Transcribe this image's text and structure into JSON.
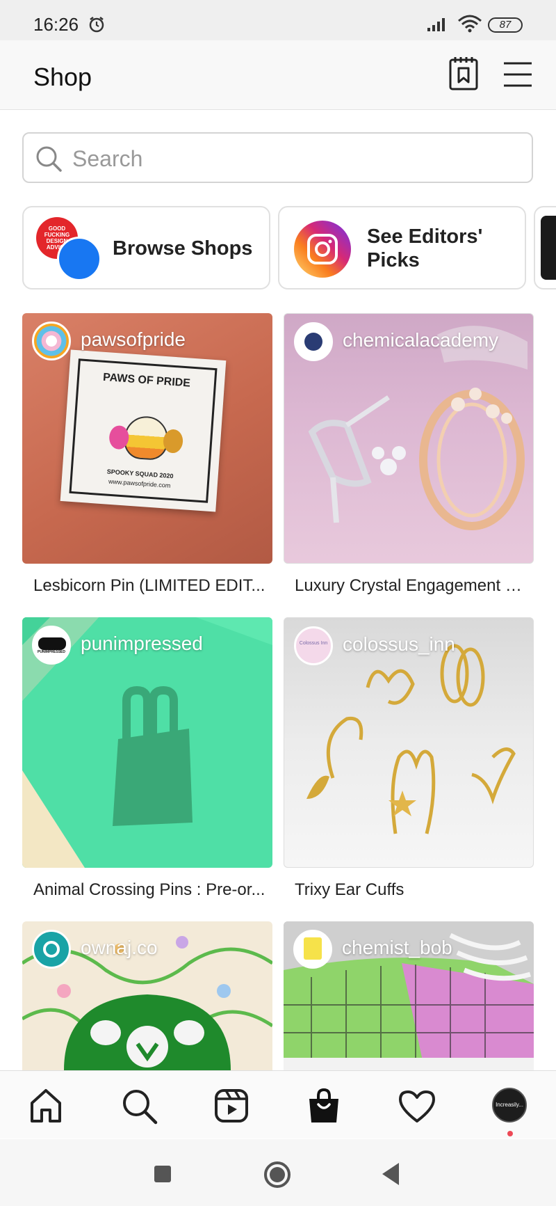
{
  "status_bar": {
    "time": "16:26",
    "battery": "87"
  },
  "header": {
    "title": "Shop"
  },
  "search": {
    "placeholder": "Search",
    "value": ""
  },
  "quick_cards": [
    {
      "label": "Browse Shops",
      "sticker_text": "GOOD FUCKING DESIGN ADVICE"
    },
    {
      "label": "See Editors' Picks"
    }
  ],
  "products": [
    {
      "shop": "pawsofpride",
      "title": "Lesbicorn Pin (LIMITED EDIT...",
      "card_text": [
        "PAWS OF PRIDE",
        "SPOOKY SQUAD 2020",
        "www.pawsofpride.com"
      ]
    },
    {
      "shop": "chemicalacademy",
      "title": "Luxury Crystal Engagement R..."
    },
    {
      "shop": "punimpressed",
      "title": "Animal Crossing Pins : Pre-or...",
      "avatar_text": "PUNIMPRESSED"
    },
    {
      "shop": "colossus_inn",
      "title": "Trixy Ear Cuffs",
      "avatar_text": "Colossus Inn"
    },
    {
      "shop": "ownaj.co",
      "title": ""
    },
    {
      "shop": "chemist_bob",
      "title": ""
    }
  ],
  "profile": {
    "avatar_text": "Increasily..."
  },
  "colors": {
    "accent": "#1877f2",
    "notification": "#ed4956",
    "instagram_gradient": [
      "#feda75",
      "#d62976",
      "#4f5bd5"
    ]
  }
}
